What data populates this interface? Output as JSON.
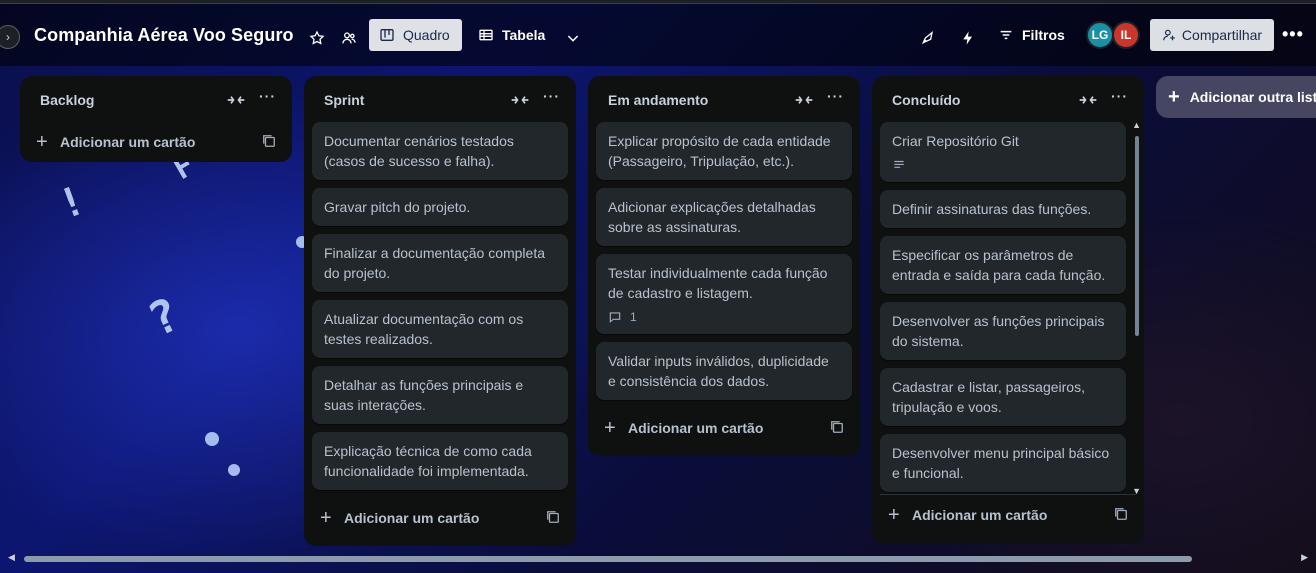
{
  "board": {
    "title": "Companhia Aérea Voo Seguro"
  },
  "header": {
    "views": [
      {
        "label": "Quadro",
        "icon": "board-icon",
        "active": true
      },
      {
        "label": "Tabela",
        "icon": "table-icon",
        "active": false
      }
    ],
    "filters_label": "Filtros",
    "share_label": "Compartilhar",
    "members": [
      {
        "initials": "LG",
        "color": "#1a8fa6"
      },
      {
        "initials": "IL",
        "color": "#c9372c"
      }
    ]
  },
  "lists": [
    {
      "title": "Backlog",
      "cards": [],
      "add_label": "Adicionar um cartão"
    },
    {
      "title": "Sprint",
      "cards": [
        {
          "text": "Documentar cenários testados (casos de sucesso e falha)."
        },
        {
          "text": "Gravar pitch do projeto."
        },
        {
          "text": "Finalizar a documentação completa do projeto."
        },
        {
          "text": "Atualizar documentação com os testes realizados."
        },
        {
          "text": "Detalhar as funções principais e suas interações."
        },
        {
          "text": "Explicação técnica de como cada funcionalidade foi implementada."
        }
      ],
      "add_label": "Adicionar um cartão"
    },
    {
      "title": "Em andamento",
      "cards": [
        {
          "text": "Explicar propósito de cada entidade (Passageiro, Tripulação, etc.)."
        },
        {
          "text": "Adicionar explicações detalhadas sobre as assinaturas."
        },
        {
          "text": "Testar individualmente cada função de cadastro e listagem.",
          "comments": "1"
        },
        {
          "text": "Validar inputs inválidos, duplicidade e consistência dos dados."
        }
      ],
      "add_label": "Adicionar um cartão"
    },
    {
      "title": "Concluído",
      "cards": [
        {
          "text": "Criar Repositório Git",
          "has_description": true
        },
        {
          "text": "Definir assinaturas das funções."
        },
        {
          "text": "Especificar os parâmetros de entrada e saída para cada função."
        },
        {
          "text": "Desenvolver as funções principais do sistema."
        },
        {
          "text": "Cadastrar e listar, passageiros, tripulação e voos."
        },
        {
          "text": "Desenvolver menu principal básico e funcional."
        }
      ],
      "add_label": "Adicionar um cartão"
    }
  ],
  "add_list_label": "Adicionar outra lista"
}
